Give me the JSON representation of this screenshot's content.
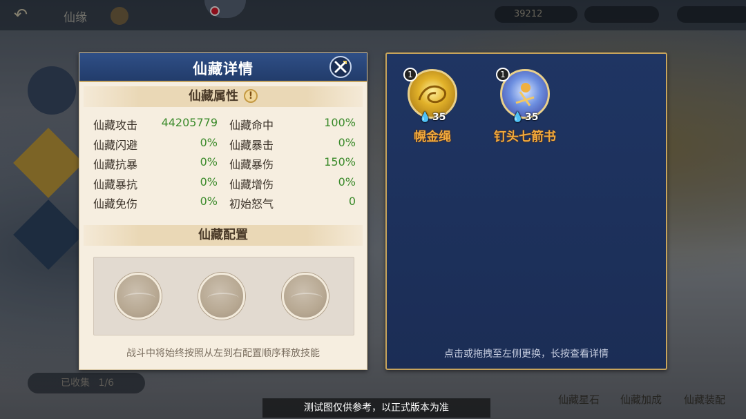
{
  "background": {
    "breadcrumb": "仙缘",
    "currency_1": "39212",
    "collected_label": "已收集",
    "collected_count": "1/6",
    "footer_buttons": [
      "仙藏星石",
      "仙藏加成",
      "仙藏装配"
    ]
  },
  "detail_panel": {
    "title": "仙藏详情",
    "attributes_header": "仙藏属性",
    "attributes": [
      {
        "label1": "仙藏攻击",
        "value1": "44205779",
        "label2": "仙藏命中",
        "value2": "100%"
      },
      {
        "label1": "仙藏闪避",
        "value1": "0%",
        "label2": "仙藏暴击",
        "value2": "0%"
      },
      {
        "label1": "仙藏抗暴",
        "value1": "0%",
        "label2": "仙藏暴伤",
        "value2": "150%"
      },
      {
        "label1": "仙藏暴抗",
        "value1": "0%",
        "label2": "仙藏增伤",
        "value2": "0%"
      },
      {
        "label1": "仙藏免伤",
        "value1": "0%",
        "label2": "初始怒气",
        "value2": "0"
      }
    ],
    "config_header": "仙藏配置",
    "slots": [
      "empty",
      "empty",
      "empty"
    ],
    "footer_note": "战斗中将始终按照从左到右配置顺序释放技能"
  },
  "item_panel": {
    "items": [
      {
        "name": "幌金绳",
        "count": "1",
        "level": "35",
        "color": "#d9a520"
      },
      {
        "name": "钉头七箭书",
        "count": "1",
        "level": "35",
        "color": "#5b7fd6"
      }
    ],
    "footer_note": "点击或拖拽至左侧更换，长按查看详情"
  },
  "watermark": "测试图仅供参考，以正式版本为准"
}
